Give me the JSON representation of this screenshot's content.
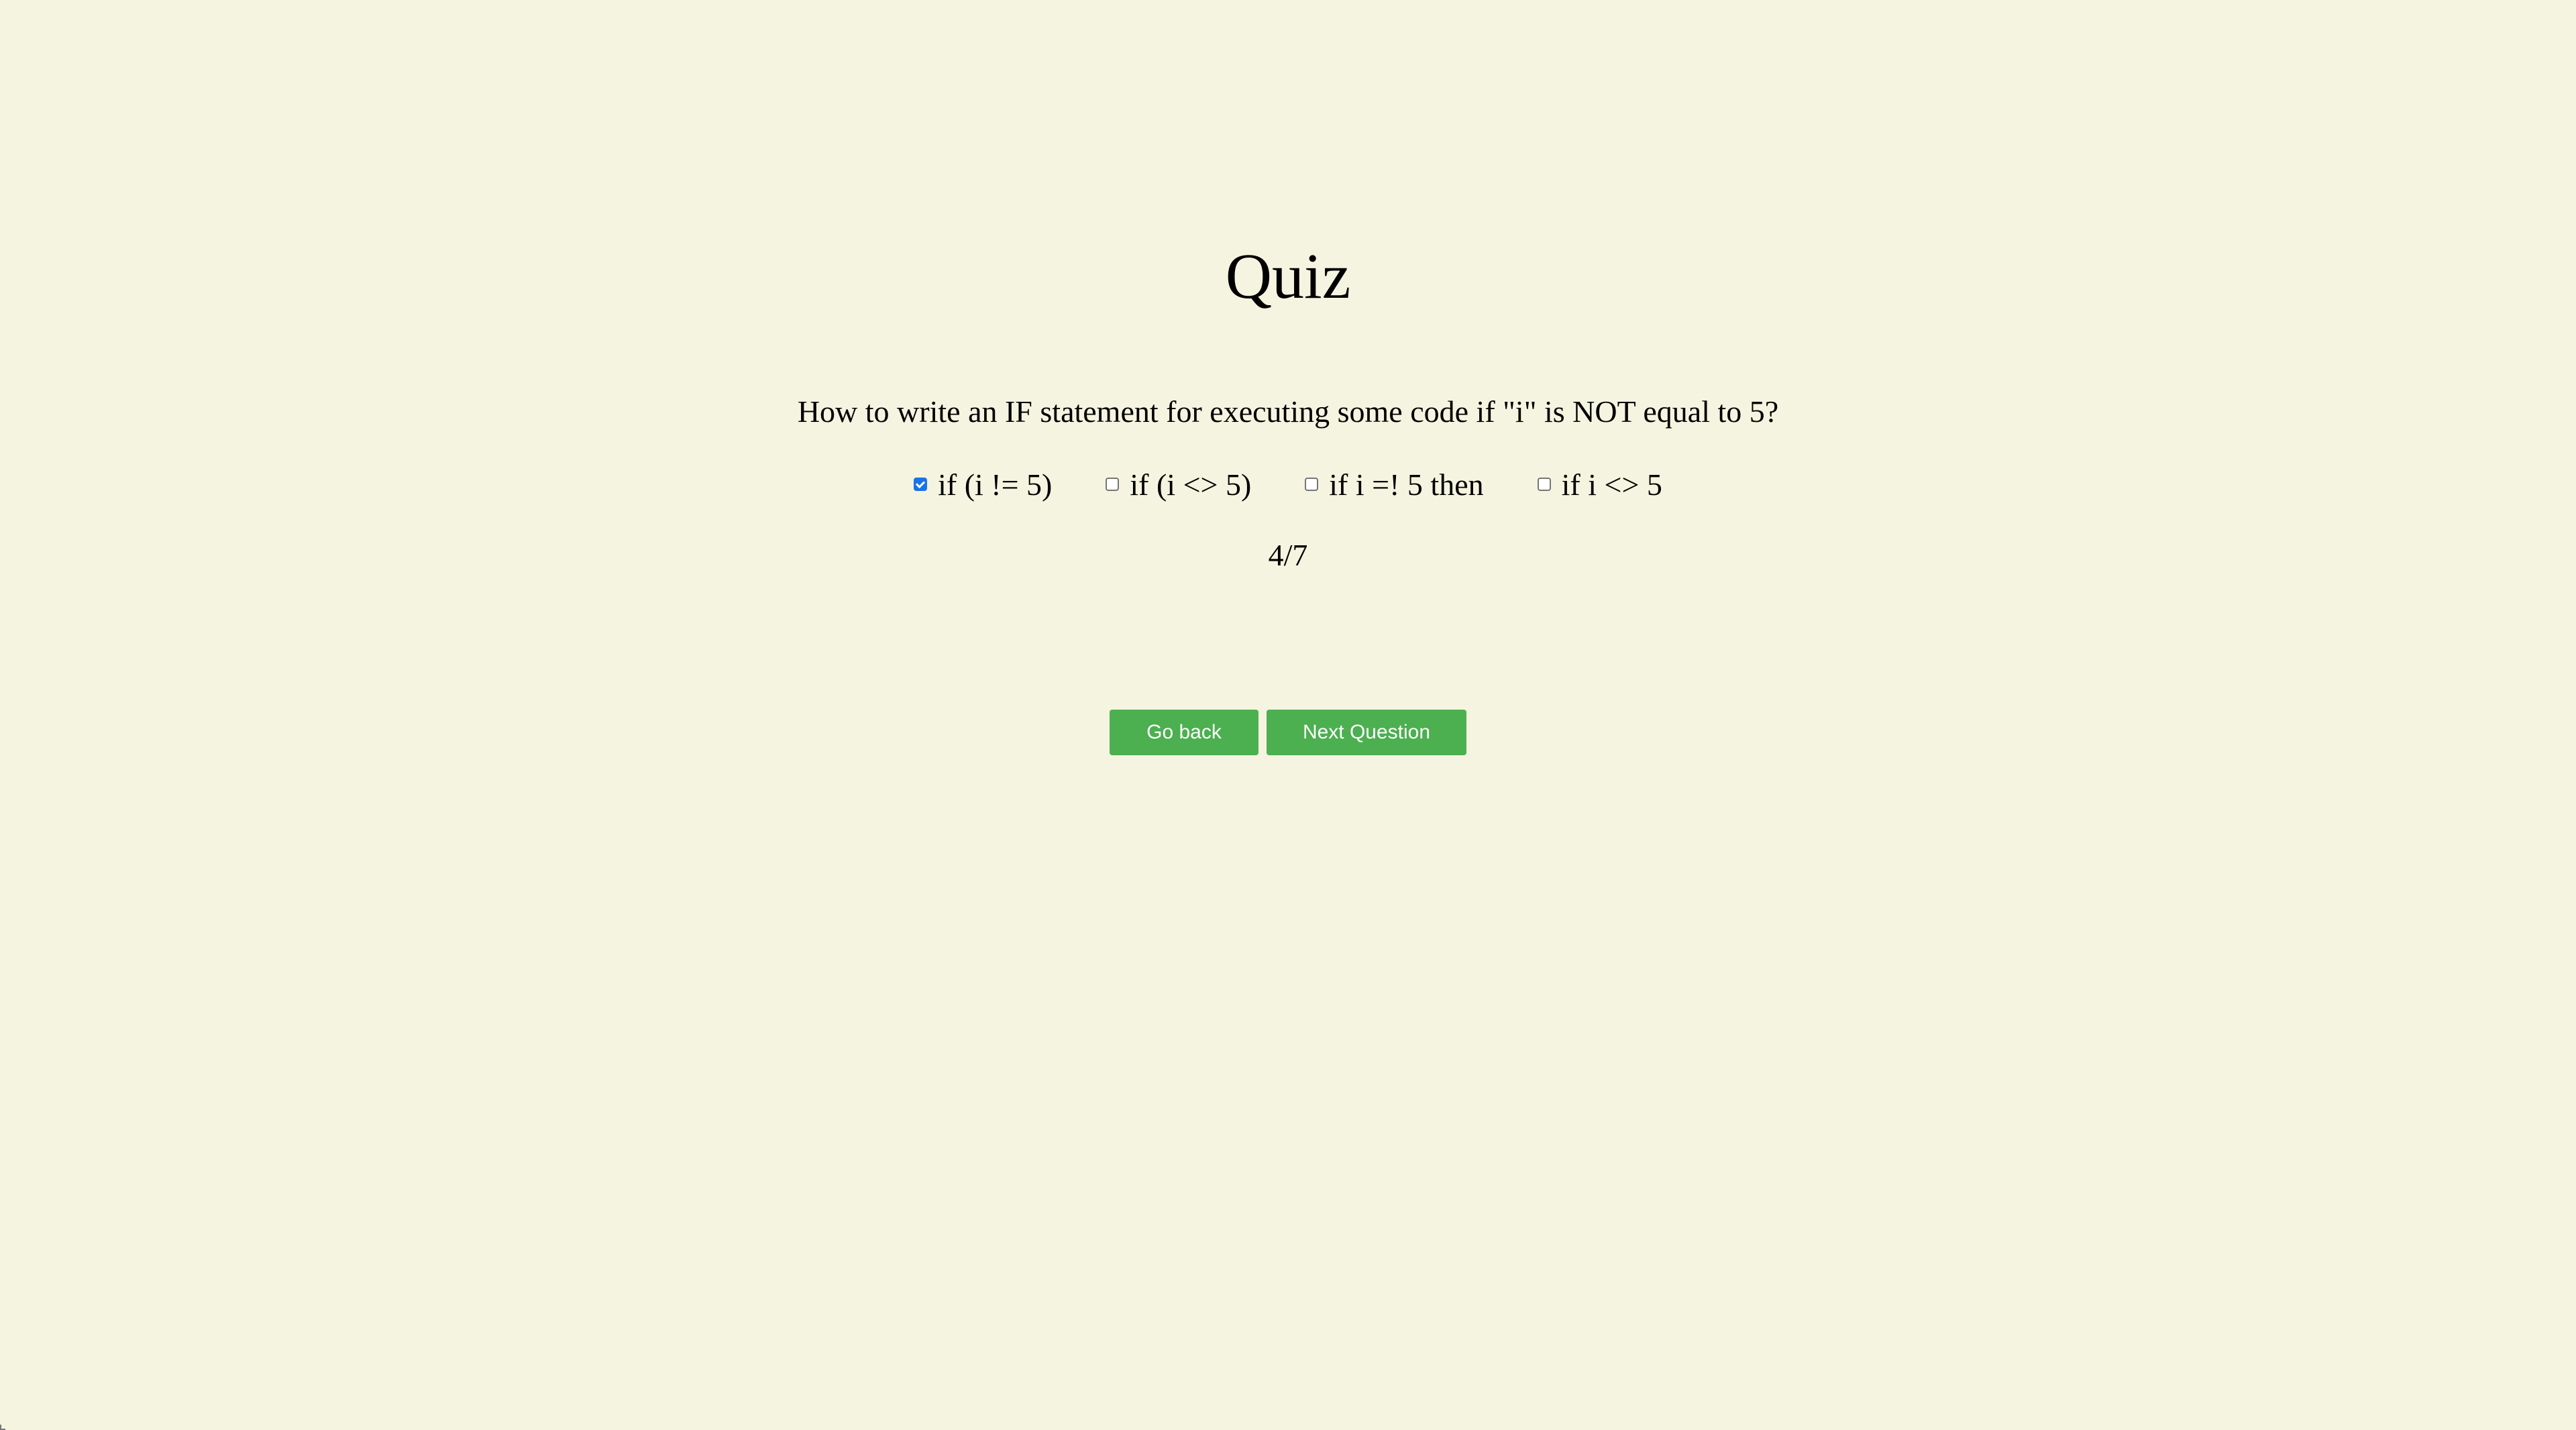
{
  "page": {
    "title": "Quiz"
  },
  "quiz": {
    "question": "How to write an IF statement for executing some code if \"i\" is NOT equal to 5?",
    "options": [
      {
        "label": "if (i != 5)",
        "checked": true
      },
      {
        "label": "if (i <> 5)",
        "checked": false
      },
      {
        "label": "if i =! 5 then",
        "checked": false
      },
      {
        "label": "if i <> 5",
        "checked": false
      }
    ],
    "progress": "4/7"
  },
  "buttons": {
    "back_label": "Go back",
    "next_label": "Next Question"
  },
  "colors": {
    "background": "#f5f4e0",
    "button": "#4caf50",
    "checkbox_checked": "#1a73e8"
  }
}
